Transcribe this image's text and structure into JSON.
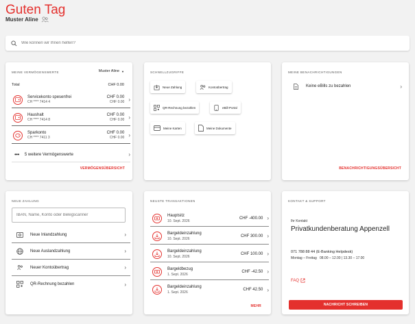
{
  "header": {
    "greeting": "Guten Tag",
    "user_name": "Muster Aline"
  },
  "search": {
    "placeholder": "Wie können wir Ihnen helfen?"
  },
  "assets": {
    "title": "MEINE VERMÖGENSWERTE",
    "owner_select": "Muster Aline",
    "total_label": "Total",
    "total_value": "CHF 0.00",
    "items": [
      {
        "name": "Servicekonto spesenfrei",
        "iban": "CH **** 7414 4",
        "amount": "CHF 0.00",
        "amount2": "CHF 0.00"
      },
      {
        "name": "Haushalt",
        "iban": "CH **** 7414 8",
        "amount": "CHF 0.00",
        "amount2": "CHF 0.00"
      },
      {
        "name": "Sparkonto",
        "iban": "CH **** 7411 3",
        "amount": "CHF 0.00",
        "amount2": "CHF 0.00"
      }
    ],
    "more_label": "5 weitere Vermögenswerte",
    "overview_link": "VERMÖGENSÜBERSICHT"
  },
  "quick": {
    "title": "SCHNELLZUGRIFFE",
    "buttons": [
      {
        "label": "Neue Zahlung",
        "icon": "payment-icon"
      },
      {
        "label": "Kontoübertrag",
        "icon": "transfer-icon"
      },
      {
        "label": "QR-Rechnung bezahlen",
        "icon": "qr-code-icon"
      },
      {
        "label": "eBill-Portal",
        "icon": "ebill-icon"
      },
      {
        "label": "Meine Karten",
        "icon": "card-icon"
      },
      {
        "label": "Meine Dokumente",
        "icon": "document-icon"
      }
    ]
  },
  "notifications": {
    "title": "MEINE BENACHRICHTIGUNGEN",
    "item": "Keine eBills zu bezahlen",
    "overview_link": "BENACHRICHTIGUNGSÜBERSICHT"
  },
  "new_payment": {
    "title": "NEUE ZAHLUNG",
    "input_placeholder": "IBAN, Name, Konto oder Belegscanner",
    "items": [
      {
        "label": "Neue Inlandzahlung",
        "icon": "domestic-payment-icon"
      },
      {
        "label": "Neue Auslandzahlung",
        "icon": "globe-icon"
      },
      {
        "label": "Neuer Kontoübertrag",
        "icon": "transfer-icon"
      },
      {
        "label": "QR-Rechnung bezahlen",
        "icon": "qr-code-icon"
      }
    ]
  },
  "transactions": {
    "title": "NEUSTE TRANSAKTIONEN",
    "items": [
      {
        "name": "Hauptsitz",
        "date": "10. Sept. 2026",
        "amount": "CHF -400.00",
        "kind": "out"
      },
      {
        "name": "Bargeldeinzahlung",
        "date": "10. Sept. 2026",
        "amount": "CHF 300.00",
        "kind": "in"
      },
      {
        "name": "Bargeldeinzahlung",
        "date": "10. Sept. 2026",
        "amount": "CHF 100.00",
        "kind": "in"
      },
      {
        "name": "Bargeldbezug",
        "date": "1. Sept. 2026",
        "amount": "CHF -42.50",
        "kind": "out"
      },
      {
        "name": "Bargeldeinzahlung",
        "date": "1. Sept. 2026",
        "amount": "CHF 42.50",
        "kind": "in"
      }
    ],
    "more_link": "MEHR"
  },
  "contact": {
    "title": "KONTAKT & SUPPORT",
    "contact_label": "Ihr Kontakt",
    "contact_name": "Privatkundenberatung Appenzell",
    "phone": "071 788 88 44 (E-Banking Helpdesk)",
    "hours": "Montag – Freitag   08.00 – 12.00 | 13.30 – 17.00",
    "faq": "FAQ",
    "message_button": "NACHRICHT SCHREIBEN"
  },
  "colors": {
    "accent": "#e4302d",
    "background": "#f2f2f2",
    "card": "#ffffff"
  }
}
